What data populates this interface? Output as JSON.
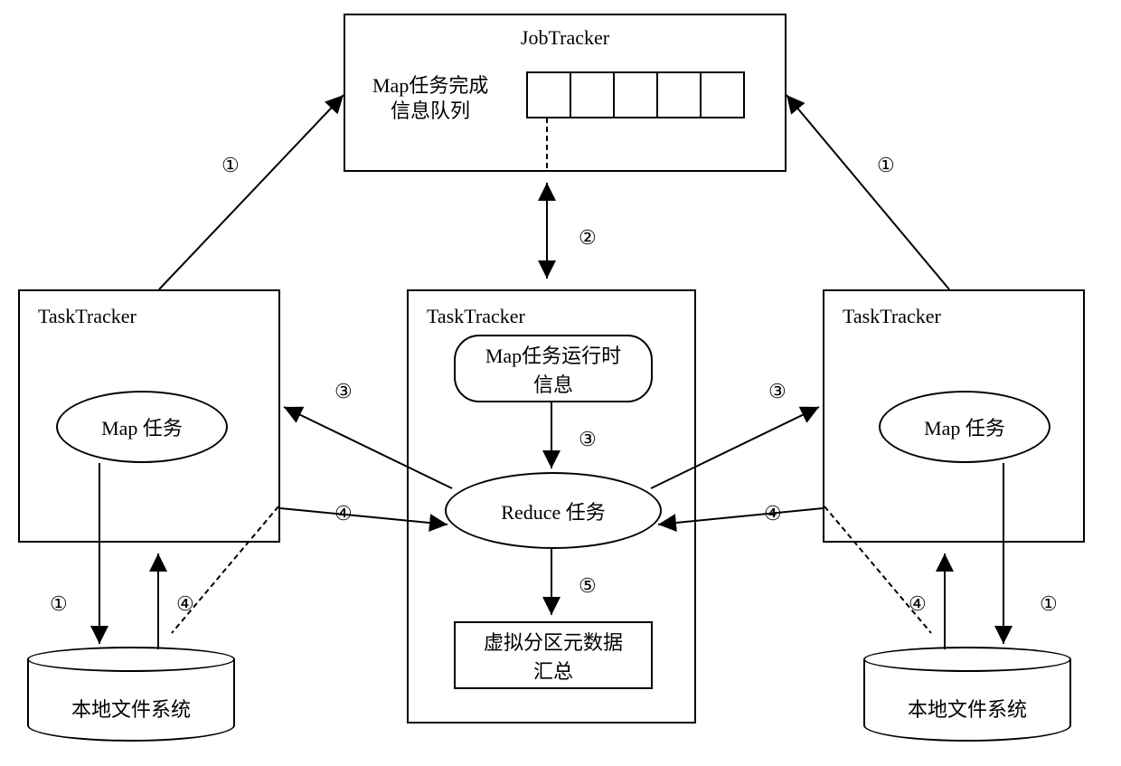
{
  "jobtracker": {
    "title": "JobTracker",
    "queue_label_line1": "Map任务完成",
    "queue_label_line2": "信息队列"
  },
  "tasktracker_left": {
    "title": "TaskTracker",
    "map_task": "Map 任务"
  },
  "tasktracker_center": {
    "title": "TaskTracker",
    "runtime_info_line1": "Map任务运行时",
    "runtime_info_line2": "信息",
    "reduce_task": "Reduce 任务",
    "summary_line1": "虚拟分区元数据",
    "summary_line2": "汇总"
  },
  "tasktracker_right": {
    "title": "TaskTracker",
    "map_task": "Map 任务"
  },
  "cylinder_left": "本地文件系统",
  "cylinder_right": "本地文件系统",
  "steps": {
    "s1": "①",
    "s2": "②",
    "s3": "③",
    "s4": "④",
    "s5": "⑤"
  }
}
